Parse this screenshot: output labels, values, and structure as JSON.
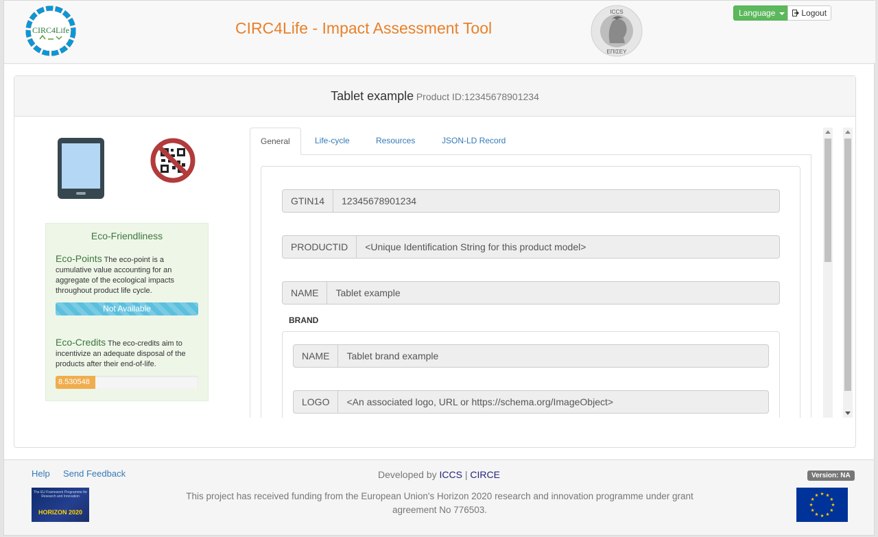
{
  "header": {
    "left_logo_text": "CIRC4Life",
    "title": "CIRC4Life - Impact Assessment Tool",
    "right_logo_text_top": "ICCS",
    "right_logo_text_bottom": "ΕΠΙΣΕΥ",
    "language_button": "Language",
    "logout_button": "Logout"
  },
  "product": {
    "name": "Tablet example",
    "id_label": "Product ID:12345678901234"
  },
  "eco": {
    "title": "Eco-Friendliness",
    "points_label": "Eco-Points",
    "points_desc": "The eco-point is a cumulative value accounting for an aggregate of the ecological impacts throughout product life cycle.",
    "points_value": "Not Available",
    "credits_label": "Eco-Credits",
    "credits_desc": "The eco-credits aim to incentivize an adequate disposal of the products after their end-of-life.",
    "credits_value": "8.530548",
    "credits_fill_fraction": 0.28
  },
  "tabs": [
    {
      "label": "General",
      "active": true
    },
    {
      "label": "Life-cycle",
      "active": false
    },
    {
      "label": "Resources",
      "active": false
    },
    {
      "label": "JSON-LD Record",
      "active": false
    }
  ],
  "general": {
    "fields": [
      {
        "key": "GTIN14",
        "value": "12345678901234"
      },
      {
        "key": "PRODUCTID",
        "value": "<Unique Identification String for this product model>"
      },
      {
        "key": "NAME",
        "value": "Tablet example"
      }
    ],
    "brand_label": "BRAND",
    "brand_fields": [
      {
        "key": "NAME",
        "value": "Tablet brand example"
      },
      {
        "key": "LOGO",
        "value": "<An associated logo, URL or https://schema.org/ImageObject>"
      }
    ]
  },
  "footer": {
    "help": "Help",
    "feedback": "Send Feedback",
    "developed_by": "Developed by",
    "dev_iccs": "ICCS",
    "dev_sep": "|",
    "dev_circe": "CIRCE",
    "funding": "This project has received funding from the European Union's Horizon 2020 research and innovation programme under grant agreement No 776503.",
    "version": "Version: NA",
    "h2020_small": "The EU Framework Programme for Research and Innovation",
    "h2020_label": "HORIZON 2020"
  },
  "colors": {
    "title_orange": "#e8802a",
    "success_green": "#5cb85c",
    "info_blue": "#5bc0de",
    "warning_orange": "#f0ad4e",
    "link_blue": "#337ab7"
  }
}
